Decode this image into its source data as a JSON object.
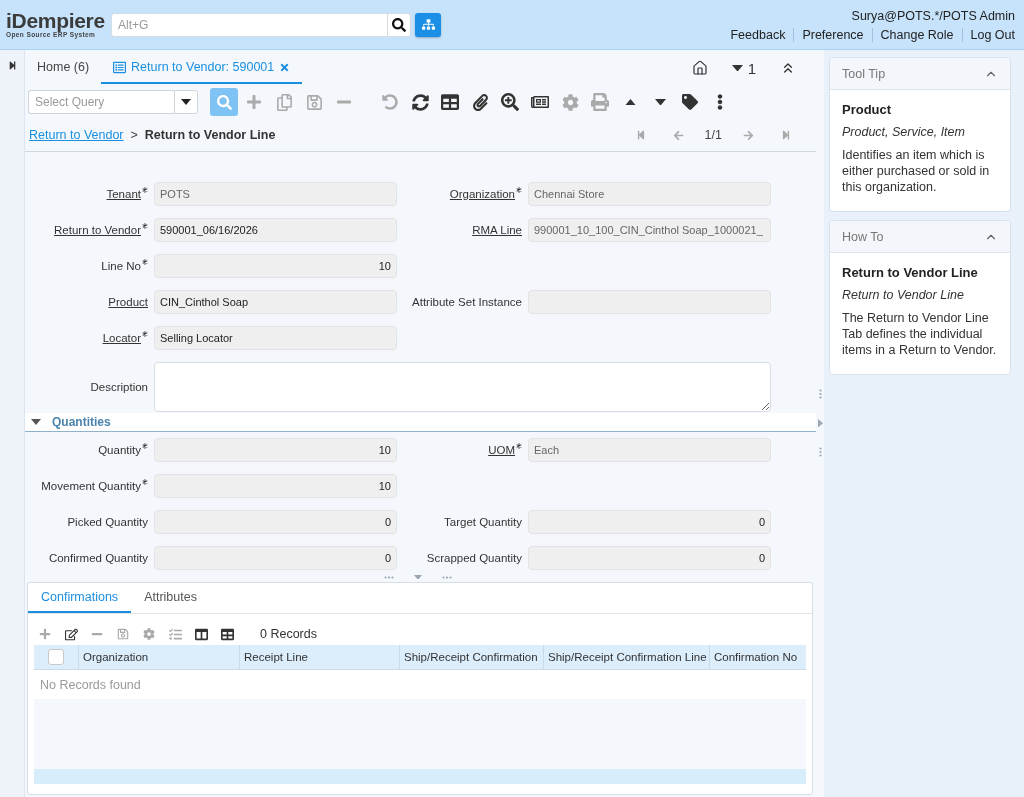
{
  "header": {
    "logo": {
      "name": "iDempiere",
      "tagline": "Open Source ERP System"
    },
    "search": {
      "placeholder": "Alt+G"
    },
    "user": "Surya@POTS.*/POTS Admin",
    "links": [
      "Feedback",
      "Preference",
      "Change Role",
      "Log Out"
    ]
  },
  "window_tabs": [
    {
      "label": "Home (6)",
      "kind": "home",
      "selected": false
    },
    {
      "label": "Return to Vendor: 590001",
      "kind": "window",
      "selected": true
    }
  ],
  "tab_menu": {
    "count": "1"
  },
  "toolbar": {
    "query": {
      "placeholder": "Select Query"
    },
    "groups": [
      [
        {
          "kind": "search",
          "active": true,
          "disabled": false
        },
        {
          "kind": "new",
          "active": false,
          "disabled": true
        },
        {
          "kind": "copy",
          "active": false,
          "disabled": true
        },
        {
          "kind": "save",
          "active": false,
          "disabled": true
        },
        {
          "kind": "delete",
          "active": false,
          "disabled": true
        }
      ],
      [
        {
          "kind": "undo",
          "active": false,
          "disabled": true
        },
        {
          "kind": "refresh",
          "active": false,
          "disabled": false
        },
        {
          "kind": "grid",
          "active": false,
          "disabled": false
        },
        {
          "kind": "attachment",
          "active": false,
          "disabled": false
        },
        {
          "kind": "zoom",
          "active": false,
          "disabled": false
        },
        {
          "kind": "report",
          "active": false,
          "disabled": false
        },
        {
          "kind": "settings",
          "active": false,
          "disabled": true
        },
        {
          "kind": "print",
          "active": false,
          "disabled": true
        },
        {
          "kind": "previous",
          "active": false,
          "disabled": false
        },
        {
          "kind": "next",
          "active": false,
          "disabled": false
        },
        {
          "kind": "tag",
          "active": false,
          "disabled": false
        },
        {
          "kind": "more",
          "active": false,
          "disabled": false
        }
      ]
    ]
  },
  "breadcrumb": {
    "parent": "Return to Vendor",
    "separator": ">",
    "current": "Return to Vendor Line"
  },
  "record_nav": {
    "position": "1/1",
    "buttons": [
      {
        "kind": "first",
        "disabled": true
      },
      {
        "kind": "previous",
        "disabled": true
      },
      {
        "kind": "next",
        "disabled": true
      },
      {
        "kind": "last",
        "disabled": true
      }
    ]
  },
  "form": {
    "rows": [
      {
        "fields": [
          {
            "label": "Tenant",
            "mandatory": true,
            "linked": true,
            "readonly": true,
            "kind": "text",
            "value": "POTS"
          },
          {
            "label": "Organization",
            "mandatory": true,
            "linked": true,
            "readonly": true,
            "kind": "text",
            "value": "Chennai Store"
          }
        ]
      },
      {
        "fields": [
          {
            "label": "Return to Vendor",
            "mandatory": true,
            "linked": true,
            "readonly": false,
            "kind": "text",
            "value": "590001_06/16/2026"
          },
          {
            "label": "RMA Line",
            "mandatory": false,
            "linked": true,
            "readonly": true,
            "kind": "text",
            "value": "990001_10_100_CIN_Cinthol Soap_1000021_"
          }
        ]
      },
      {
        "fields": [
          {
            "label": "Line No",
            "mandatory": true,
            "linked": false,
            "readonly": false,
            "kind": "number",
            "value": "10"
          }
        ]
      },
      {
        "fields": [
          {
            "label": "Product",
            "mandatory": false,
            "linked": true,
            "readonly": false,
            "kind": "text",
            "value": "CIN_Cinthol Soap"
          },
          {
            "label": "Attribute Set Instance",
            "mandatory": false,
            "linked": false,
            "kind": "text"
          }
        ]
      },
      {
        "fields": [
          {
            "label": "Locator",
            "mandatory": true,
            "linked": true,
            "readonly": false,
            "kind": "text",
            "value": "Selling Locator"
          }
        ]
      },
      {
        "fields": [
          {
            "label": "Description",
            "mandatory": false,
            "linked": false,
            "kind": "textarea"
          }
        ]
      }
    ],
    "sections": [
      {
        "title": "Quantities",
        "expanded": true,
        "rows": [
          {
            "fields": [
              {
                "label": "Quantity",
                "mandatory": true,
                "linked": false,
                "readonly": false,
                "kind": "number",
                "value": "10"
              },
              {
                "label": "UOM",
                "mandatory": true,
                "linked": true,
                "readonly": true,
                "kind": "text",
                "value": "Each"
              }
            ]
          },
          {
            "fields": [
              {
                "label": "Movement Quantity",
                "mandatory": true,
                "linked": false,
                "readonly": false,
                "kind": "number",
                "value": "10"
              }
            ]
          },
          {
            "fields": [
              {
                "label": "Picked Quantity",
                "mandatory": false,
                "linked": false,
                "readonly": false,
                "kind": "number",
                "value": "0"
              },
              {
                "label": "Target Quantity",
                "mandatory": false,
                "linked": false,
                "readonly": false,
                "kind": "number",
                "value": "0"
              }
            ]
          },
          {
            "fields": [
              {
                "label": "Confirmed Quantity",
                "mandatory": false,
                "linked": false,
                "readonly": false,
                "kind": "number",
                "value": "0"
              },
              {
                "label": "Scrapped Quantity",
                "mandatory": false,
                "linked": false,
                "readonly": false,
                "kind": "number",
                "value": "0"
              }
            ]
          }
        ]
      }
    ]
  },
  "detail": {
    "tabs": [
      {
        "label": "Confirmations",
        "selected": true
      },
      {
        "label": "Attributes",
        "selected": false
      }
    ],
    "toolbar": [
      {
        "kind": "new",
        "disabled": true
      },
      {
        "kind": "edit",
        "disabled": false
      },
      {
        "kind": "delete",
        "disabled": true
      },
      {
        "kind": "save",
        "disabled": true
      },
      {
        "kind": "settings",
        "disabled": true
      },
      {
        "kind": "process",
        "disabled": true
      },
      {
        "kind": "columns",
        "disabled": false
      },
      {
        "kind": "grid",
        "disabled": false
      }
    ],
    "record_count": "0 Records",
    "table": {
      "select_all": {
        "checked": false
      },
      "columns": [
        "Organization",
        "Receipt Line",
        "Ship/Receipt Confirmation",
        "Ship/Receipt Confirmation Line",
        "Confirmation No"
      ],
      "empty_message": "No Records found"
    }
  },
  "help_panels": [
    {
      "title": "Tool Tip",
      "expanded": true,
      "heading": "Product",
      "subtitle": "Product, Service, Item",
      "text": "Identifies an item which is either purchased or sold in this organization."
    },
    {
      "title": "How To",
      "expanded": true,
      "heading": "Return to Vendor Line",
      "subtitle": "Return to Vendor Line",
      "text": "The Return to Vendor Line Tab defines the individual items in a Return to Vendor."
    }
  ]
}
